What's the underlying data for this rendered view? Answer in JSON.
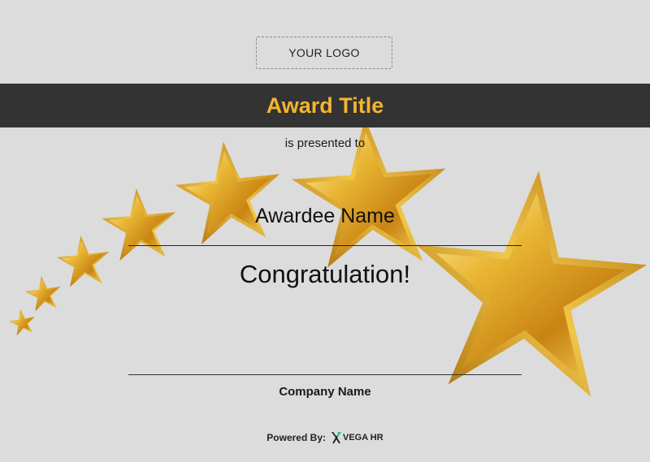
{
  "logo": {
    "placeholder": "YOUR LOGO"
  },
  "award": {
    "title": "Award Title",
    "presented_to": "is presented to",
    "awardee_name": "Awardee Name",
    "congratulation": "Congratulation!",
    "company_name": "Company Name"
  },
  "footer": {
    "powered_by": "Powered By:",
    "brand": "VEGA HR"
  },
  "colors": {
    "background": "#dcdcdc",
    "title_bar": "#333333",
    "title_text": "#f3b431",
    "star_gold": "#e7b22c"
  },
  "decoration": {
    "star_count": 7
  }
}
